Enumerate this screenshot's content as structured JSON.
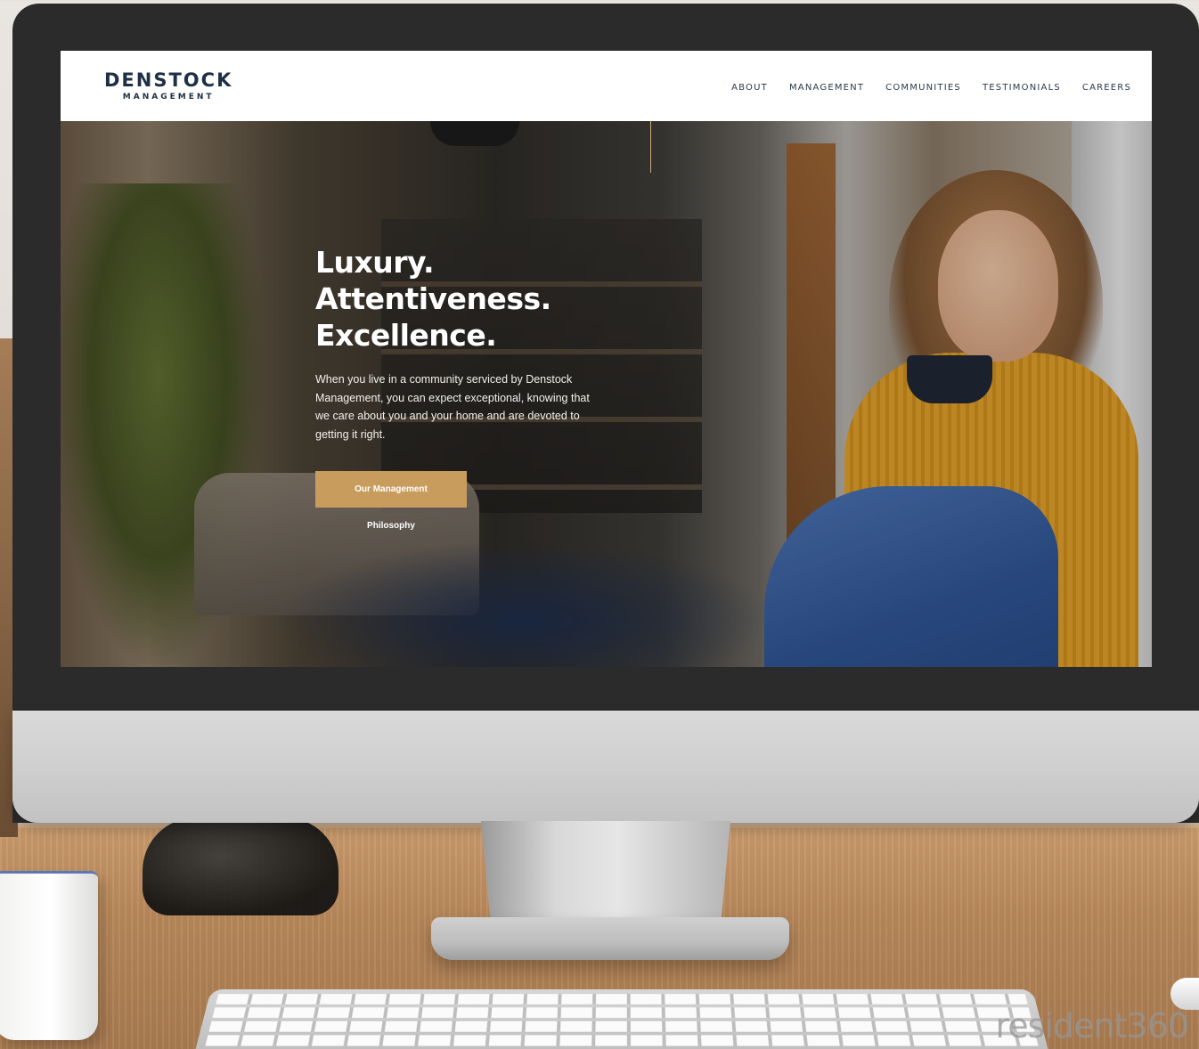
{
  "header": {
    "logo_name": "DENSTOCK",
    "logo_sub": "MANAGEMENT",
    "nav": [
      "ABOUT",
      "MANAGEMENT",
      "COMMUNITIES",
      "TESTIMONIALS",
      "CAREERS"
    ]
  },
  "hero": {
    "title_lines": [
      "Luxury.",
      "Attentiveness.",
      "Excellence."
    ],
    "body": "When you live in a community serviced by Denstock Management, you can expect exceptional, knowing that we care about you and your home and are devoted to getting it right.",
    "button_label": "Our Management Philosophy"
  },
  "watermark": "resident360",
  "colors": {
    "brand_navy": "#1e3045",
    "accent_gold": "#c89c5c",
    "header_bg": "#ffffff"
  }
}
